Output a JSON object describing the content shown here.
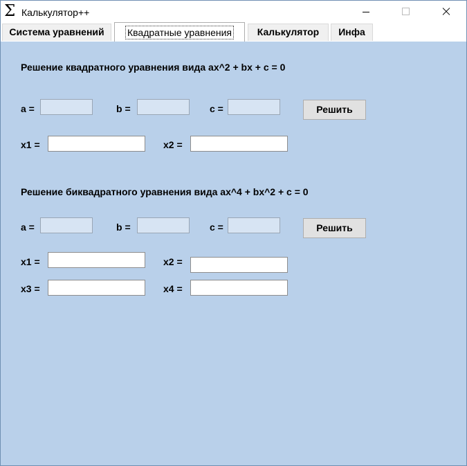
{
  "window": {
    "icon": "Σ",
    "title": "Калькулятор++"
  },
  "tabs": [
    {
      "label": "Система уравнений",
      "active": false
    },
    {
      "label": "Квадратные уравнения",
      "active": true
    },
    {
      "label": "Калькулятор",
      "active": false
    },
    {
      "label": "Инфа",
      "active": false
    }
  ],
  "quadratic": {
    "heading": "Решение квадратного уравнения вида ax^2 + bx + c = 0",
    "label_a": "a =",
    "label_b": "b =",
    "label_c": "c =",
    "value_a": "",
    "value_b": "",
    "value_c": "",
    "solve_label": "Решить",
    "label_x1": "x1 =",
    "label_x2": "x2 =",
    "value_x1": "",
    "value_x2": ""
  },
  "biquadratic": {
    "heading": "Решение биквадратного уравнения вида ax^4 + bx^2 + c = 0",
    "label_a": "a =",
    "label_b": "b =",
    "label_c": "c =",
    "value_a": "",
    "value_b": "",
    "value_c": "",
    "solve_label": "Решить",
    "label_x1": "x1 =",
    "label_x2": "x2 =",
    "label_x3": "x3 =",
    "label_x4": "x4 =",
    "value_x1": "",
    "value_x2": "",
    "value_x3": "",
    "value_x4": ""
  },
  "colors": {
    "content_bg": "#b9d0ea",
    "coef_input_bg": "#d7e4f3",
    "button_bg": "#e1e1e1"
  }
}
